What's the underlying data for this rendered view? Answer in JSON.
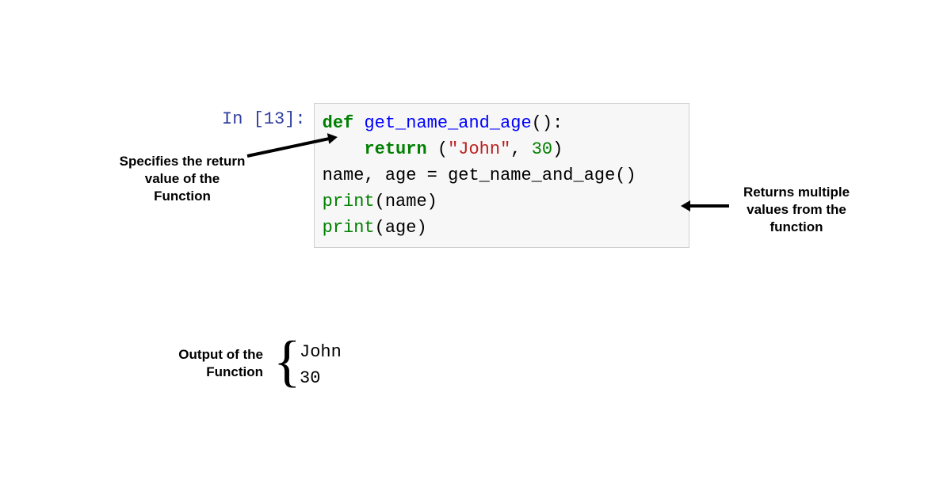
{
  "cell": {
    "prompt": "In [13]:",
    "code": {
      "line1": {
        "def": "def",
        "fname": "get_name_and_age",
        "parens": "():"
      },
      "line2": {
        "indent": "    ",
        "return": "return",
        "open": " (",
        "str": "\"John\"",
        "comma": ", ",
        "num": "30",
        "close": ")"
      },
      "line3": "",
      "line4": {
        "lhs": "name, age = ",
        "fname": "get_name_and_age",
        "parens": "()"
      },
      "line5": {
        "builtin": "print",
        "args": "(name)"
      },
      "line6": {
        "builtin": "print",
        "args": "(age)"
      }
    }
  },
  "output": {
    "line1": "John",
    "line2": "30"
  },
  "annotations": {
    "left": "Specifies the return value of the Function",
    "right": "Returns multiple values from the function",
    "output": "Output of the Function"
  },
  "brace": "{"
}
